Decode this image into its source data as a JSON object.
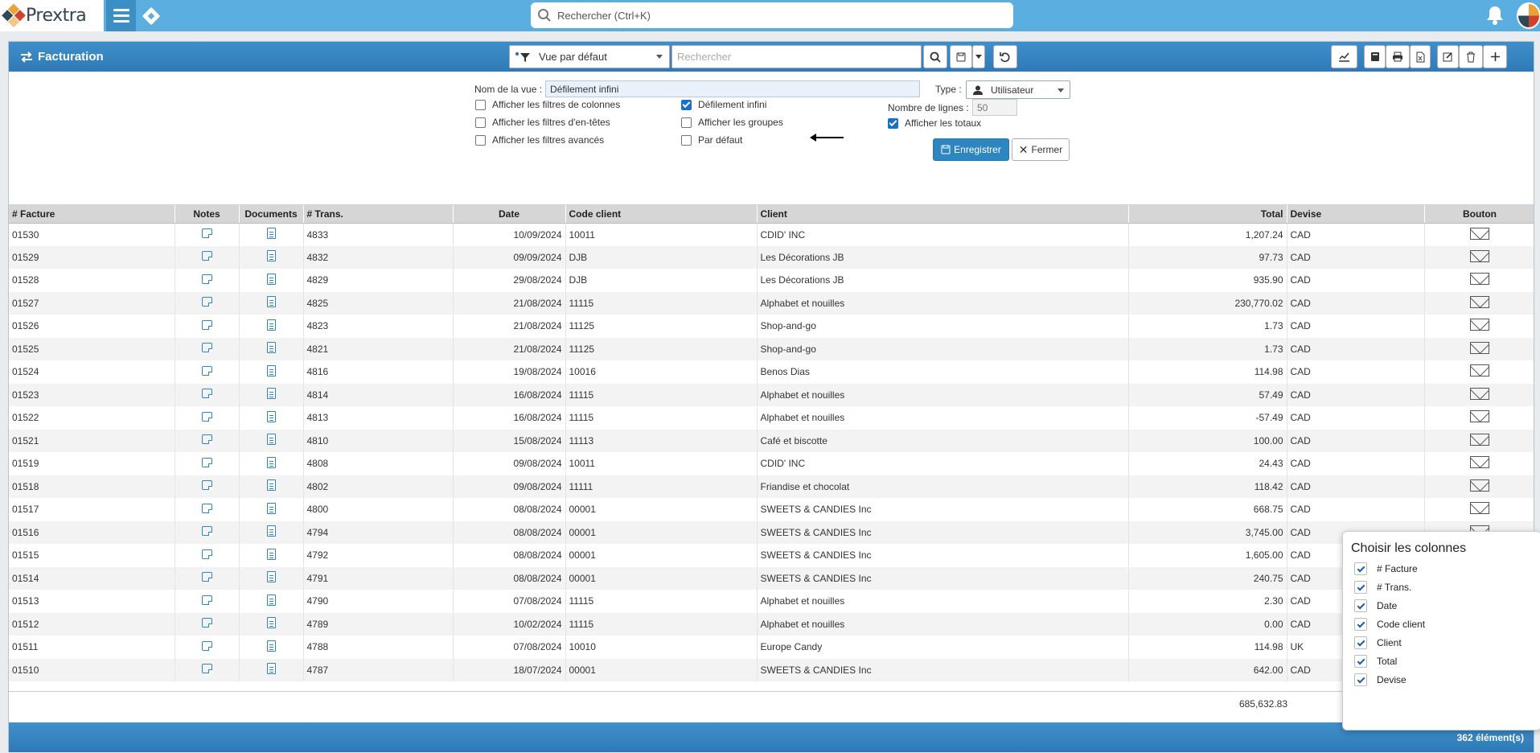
{
  "topbar": {
    "brand": "Prextra",
    "search_placeholder": "Rechercher (Ctrl+K)"
  },
  "panel": {
    "title": "Facturation",
    "view_select": "Vue par défaut",
    "grid_search_placeholder": "Rechercher"
  },
  "form": {
    "view_name_label": "Nom de la vue :",
    "view_name_value": "Défilement infini",
    "type_label": "Type :",
    "type_value": "Utilisateur",
    "cb_col_filters": "Afficher les filtres de colonnes",
    "cb_header_filters": "Afficher les filtres d'en-têtes",
    "cb_adv_filters": "Afficher les filtres avancés",
    "cb_infinite": "Défilement infini",
    "cb_groups": "Afficher les groupes",
    "cb_default": "Par défaut",
    "rows_label": "Nombre de lignes :",
    "rows_value": "50",
    "cb_totals": "Afficher les totaux",
    "save_label": "Enregistrer",
    "close_label": "Fermer",
    "checked": {
      "col_filters": false,
      "header_filters": false,
      "adv_filters": false,
      "infinite": true,
      "groups": false,
      "default": false,
      "totals": true
    }
  },
  "table": {
    "headers": [
      "# Facture",
      "Notes",
      "Documents",
      "# Trans.",
      "Date",
      "Code client",
      "Client",
      "Total",
      "Devise",
      "Bouton"
    ],
    "rows": [
      [
        "01530",
        "4833",
        "10/09/2024",
        "10011",
        "CDID' INC",
        "1,207.24",
        "CAD"
      ],
      [
        "01529",
        "4832",
        "09/09/2024",
        "DJB",
        "Les Décorations JB",
        "97.73",
        "CAD"
      ],
      [
        "01528",
        "4829",
        "29/08/2024",
        "DJB",
        "Les Décorations JB",
        "935.90",
        "CAD"
      ],
      [
        "01527",
        "4825",
        "21/08/2024",
        "11115",
        "Alphabet et nouilles",
        "230,770.02",
        "CAD"
      ],
      [
        "01526",
        "4823",
        "21/08/2024",
        "11125",
        "Shop-and-go",
        "1.73",
        "CAD"
      ],
      [
        "01525",
        "4821",
        "21/08/2024",
        "11125",
        "Shop-and-go",
        "1.73",
        "CAD"
      ],
      [
        "01524",
        "4816",
        "19/08/2024",
        "10016",
        "Benos Dias",
        "114.98",
        "CAD"
      ],
      [
        "01523",
        "4814",
        "16/08/2024",
        "11115",
        "Alphabet et nouilles",
        "57.49",
        "CAD"
      ],
      [
        "01522",
        "4813",
        "16/08/2024",
        "11115",
        "Alphabet et nouilles",
        "-57.49",
        "CAD"
      ],
      [
        "01521",
        "4810",
        "15/08/2024",
        "11113",
        "Café et biscotte",
        "100.00",
        "CAD"
      ],
      [
        "01519",
        "4808",
        "09/08/2024",
        "10011",
        "CDID' INC",
        "24.43",
        "CAD"
      ],
      [
        "01518",
        "4802",
        "09/08/2024",
        "11111",
        "Friandise et chocolat",
        "118.42",
        "CAD"
      ],
      [
        "01517",
        "4800",
        "08/08/2024",
        "00001",
        "SWEETS & CANDIES Inc",
        "668.75",
        "CAD"
      ],
      [
        "01516",
        "4794",
        "08/08/2024",
        "00001",
        "SWEETS & CANDIES Inc",
        "3,745.00",
        "CAD"
      ],
      [
        "01515",
        "4792",
        "08/08/2024",
        "00001",
        "SWEETS & CANDIES Inc",
        "1,605.00",
        "CAD"
      ],
      [
        "01514",
        "4791",
        "08/08/2024",
        "00001",
        "SWEETS & CANDIES Inc",
        "240.75",
        "CAD"
      ],
      [
        "01513",
        "4790",
        "07/08/2024",
        "11115",
        "Alphabet et nouilles",
        "2.30",
        "CAD"
      ],
      [
        "01512",
        "4789",
        "10/02/2024",
        "11115",
        "Alphabet et nouilles",
        "0.00",
        "CAD"
      ],
      [
        "01511",
        "4788",
        "07/08/2024",
        "10010",
        "Europe Candy",
        "114.98",
        "UK"
      ],
      [
        "01510",
        "4787",
        "18/07/2024",
        "00001",
        "SWEETS & CANDIES Inc",
        "642.00",
        "CAD"
      ]
    ],
    "total": "685,632.83",
    "count": "362 élément(s)"
  },
  "column_chooser": {
    "title": "Choisir les colonnes",
    "items": [
      "# Facture",
      "# Trans.",
      "Date",
      "Code client",
      "Client",
      "Total",
      "Devise"
    ]
  }
}
